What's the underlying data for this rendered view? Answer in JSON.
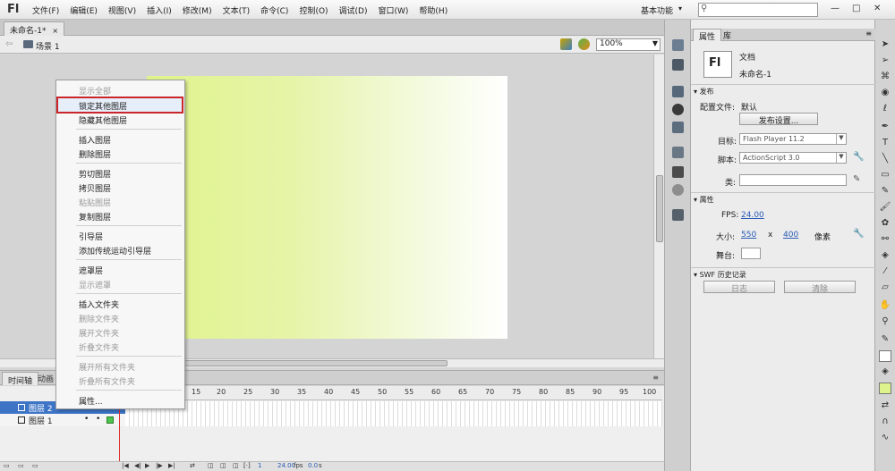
{
  "app": {
    "logo": "Fl",
    "menus": [
      "文件(F)",
      "编辑(E)",
      "视图(V)",
      "插入(I)",
      "修改(M)",
      "文本(T)",
      "命令(C)",
      "控制(O)",
      "调试(D)",
      "窗口(W)",
      "帮助(H)"
    ],
    "workspace": "基本功能",
    "workspace_chevron": "▾",
    "search_placeholder": "",
    "window_min": "—",
    "window_max": "□",
    "window_close": "✕"
  },
  "document": {
    "tab_title": "未命名-1*",
    "tab_close": "×",
    "scene": "场景 1",
    "zoom": "100%",
    "stage_gradient": [
      "#dff38c",
      "#ffffff"
    ]
  },
  "context_menu": {
    "items": [
      {
        "label": "显示全部",
        "disabled": true
      },
      {
        "label": "锁定其他图层",
        "disabled": false,
        "highlighted": true
      },
      {
        "label": "隐藏其他图层",
        "disabled": false
      },
      {
        "label": "插入图层",
        "disabled": false
      },
      {
        "label": "删除图层",
        "disabled": false
      },
      {
        "label": "剪切图层",
        "disabled": false
      },
      {
        "label": "拷贝图层",
        "disabled": false
      },
      {
        "label": "粘贴图层",
        "disabled": true
      },
      {
        "label": "复制图层",
        "disabled": false
      },
      {
        "label": "引导层",
        "disabled": false
      },
      {
        "label": "添加传统运动引导层",
        "disabled": false
      },
      {
        "label": "遮罩层",
        "disabled": false
      },
      {
        "label": "显示遮罩",
        "disabled": true
      },
      {
        "label": "插入文件夹",
        "disabled": false
      },
      {
        "label": "删除文件夹",
        "disabled": true
      },
      {
        "label": "展开文件夹",
        "disabled": true
      },
      {
        "label": "折叠文件夹",
        "disabled": true
      },
      {
        "label": "展开所有文件夹",
        "disabled": true
      },
      {
        "label": "折叠所有文件夹",
        "disabled": true
      },
      {
        "label": "属性...",
        "disabled": false
      }
    ]
  },
  "timeline": {
    "tab_timeline": "时间轴",
    "tab_motion": "动画",
    "ruler_ticks": [
      "15",
      "20",
      "25",
      "30",
      "35",
      "40",
      "45",
      "50",
      "55",
      "60",
      "65",
      "70",
      "75",
      "80",
      "85",
      "90",
      "95",
      "100"
    ],
    "layers": [
      {
        "name": "图层 2",
        "selected": true
      },
      {
        "name": "图层 1",
        "selected": false
      }
    ],
    "status": {
      "frame": "1",
      "fps": "24.00",
      "fps_unit": "fps",
      "time": "0.0",
      "time_unit": "s"
    }
  },
  "properties": {
    "tab_properties": "属性",
    "tab_library": "库",
    "doc_icon": "Fl",
    "doc_type": "文档",
    "doc_name": "未命名-1",
    "section_publish": "发布",
    "profile_label": "配置文件:",
    "profile_value": "默认",
    "publish_settings_btn": "发布设置...",
    "target_label": "目标:",
    "target_value": "Flash Player 11.2",
    "script_label": "脚本:",
    "script_value": "ActionScript 3.0",
    "class_label": "类:",
    "section_props": "属性",
    "fps_label": "FPS:",
    "fps_value": "24.00",
    "size_label": "大小:",
    "width": "550",
    "x_sep": "x",
    "height": "400",
    "unit": "像素",
    "stage_label": "舞台:",
    "section_swf": "SWF 历史记录",
    "log_btn": "日志",
    "clear_btn": "清除"
  }
}
